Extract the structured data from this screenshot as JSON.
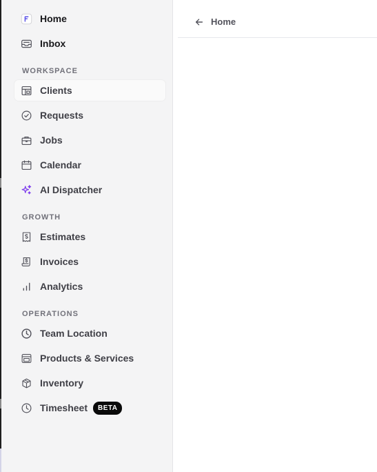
{
  "sidebar": {
    "top_items": [
      {
        "label": "Home",
        "icon": "app-logo-icon"
      },
      {
        "label": "Inbox",
        "icon": "inbox-icon"
      }
    ],
    "sections": [
      {
        "title": "WORKSPACE",
        "items": [
          {
            "label": "Clients",
            "icon": "clients-icon",
            "active": true
          },
          {
            "label": "Requests",
            "icon": "check-circle-icon"
          },
          {
            "label": "Jobs",
            "icon": "briefcase-icon"
          },
          {
            "label": "Calendar",
            "icon": "calendar-icon"
          },
          {
            "label": "AI Dispatcher",
            "icon": "sparkles-icon",
            "accent": "#7c3aed"
          }
        ]
      },
      {
        "title": "GROWTH",
        "items": [
          {
            "label": "Estimates",
            "icon": "receipt-dollar-icon"
          },
          {
            "label": "Invoices",
            "icon": "invoice-icon"
          },
          {
            "label": "Analytics",
            "icon": "bar-chart-icon"
          }
        ]
      },
      {
        "title": "OPERATIONS",
        "items": [
          {
            "label": "Team Location",
            "icon": "clock-icon"
          },
          {
            "label": "Products & Services",
            "icon": "storefront-icon"
          },
          {
            "label": "Inventory",
            "icon": "package-icon"
          },
          {
            "label": "Timesheet",
            "icon": "clock-icon",
            "badge": "BETA"
          }
        ]
      }
    ]
  },
  "main": {
    "breadcrumb": {
      "label": "Home",
      "icon": "arrow-left-icon"
    }
  }
}
